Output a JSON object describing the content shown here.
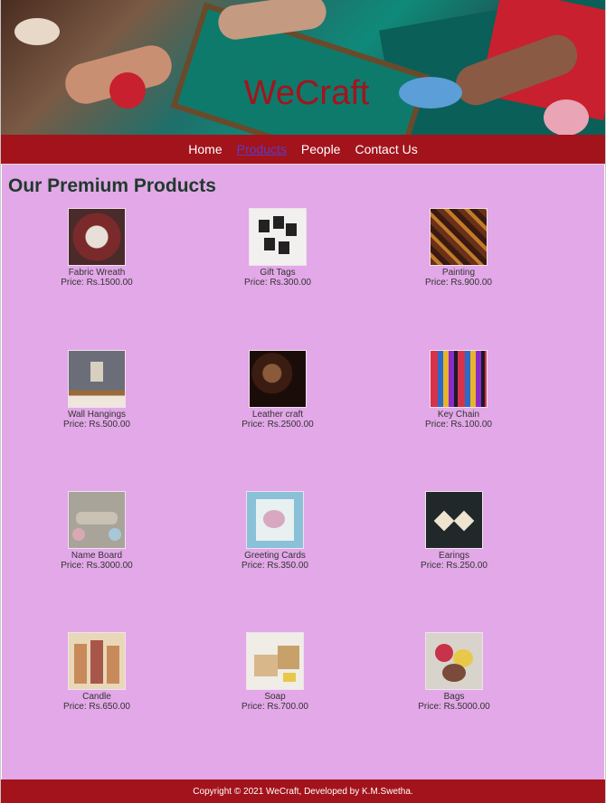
{
  "site": {
    "title": "WeCraft"
  },
  "nav": {
    "items": [
      {
        "label": "Home",
        "active": false
      },
      {
        "label": "Products",
        "active": true
      },
      {
        "label": "People",
        "active": false
      },
      {
        "label": "Contact Us",
        "active": false
      }
    ]
  },
  "main": {
    "heading": "Our Premium Products",
    "products": [
      {
        "name": "Fabric Wreath",
        "price": "Price: Rs.1500.00",
        "icon": "fabric-wreath-image"
      },
      {
        "name": "Gift Tags",
        "price": "Price: Rs.300.00",
        "icon": "gift-tags-image"
      },
      {
        "name": "Painting",
        "price": "Price: Rs.900.00",
        "icon": "painting-image"
      },
      {
        "name": "Wall Hangings",
        "price": "Price: Rs.500.00",
        "icon": "wall-hangings-image"
      },
      {
        "name": "Leather craft",
        "price": "Price: Rs.2500.00",
        "icon": "leather-craft-image"
      },
      {
        "name": "Key Chain",
        "price": "Price: Rs.100.00",
        "icon": "key-chain-image"
      },
      {
        "name": "Name Board",
        "price": "Price: Rs.3000.00",
        "icon": "name-board-image"
      },
      {
        "name": "Greeting Cards",
        "price": "Price: Rs.350.00",
        "icon": "greeting-cards-image"
      },
      {
        "name": "Earings",
        "price": "Price: Rs.250.00",
        "icon": "earings-image"
      },
      {
        "name": "Candle",
        "price": "Price: Rs.650.00",
        "icon": "candle-image"
      },
      {
        "name": "Soap",
        "price": "Price: Rs.700.00",
        "icon": "soap-image"
      },
      {
        "name": "Bags",
        "price": "Price: Rs.5000.00",
        "icon": "bags-image"
      }
    ]
  },
  "footer": {
    "text": "Copyright © 2021 WeCraft, Developed by K.M.Swetha."
  },
  "colors": {
    "nav_bg": "#a3131b",
    "main_bg": "#e2a8e7",
    "title": "#a3141c",
    "heading": "#1f3a2c",
    "active_link": "#5b3cc4"
  }
}
